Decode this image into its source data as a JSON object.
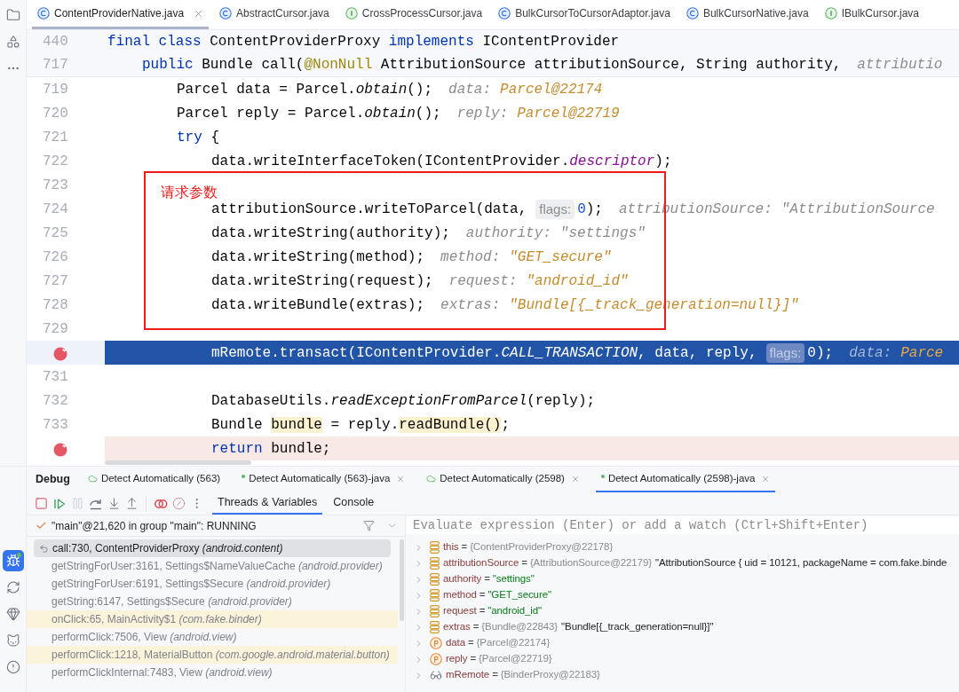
{
  "tool_strip": {
    "top": [
      {
        "kind": "project",
        "selected": false
      },
      {
        "kind": "structure",
        "selected": false
      },
      {
        "kind": "more",
        "selected": false
      }
    ],
    "bottom": [
      {
        "kind": "debug",
        "selected": true
      },
      {
        "kind": "sync",
        "selected": false
      },
      {
        "kind": "gem",
        "selected": false
      },
      {
        "kind": "cat",
        "selected": false
      },
      {
        "kind": "problems",
        "selected": false
      }
    ]
  },
  "editor_tabs": [
    {
      "label": "ContentProviderNative.java",
      "kind": "class",
      "selected": true
    },
    {
      "label": "AbstractCursor.java",
      "kind": "class",
      "selected": false
    },
    {
      "label": "CrossProcessCursor.java",
      "kind": "interface",
      "selected": false
    },
    {
      "label": "BulkCursorToCursorAdaptor.java",
      "kind": "class",
      "selected": false
    },
    {
      "label": "BulkCursorNative.java",
      "kind": "class",
      "selected": false
    },
    {
      "label": "IBulkCursor.java",
      "kind": "interface",
      "selected": false
    }
  ],
  "editor": {
    "lines": [
      {
        "number": "440",
        "pinned": true,
        "breakpoint": false,
        "current": false,
        "parts": [
          {
            "kind": "code",
            "tokens": [
              {
                "kind": "keyword",
                "text": "final class"
              },
              {
                "kind": "plain",
                "text": " ContentProviderProxy "
              },
              {
                "kind": "keyword",
                "text": "implements"
              },
              {
                "kind": "plain",
                "text": " IContentProvider"
              }
            ]
          }
        ],
        "children": [
          {
            "number": "717",
            "pinned": true,
            "breakpoint": false,
            "current": false,
            "parts": [
              {
                "kind": "code",
                "tokens": [
                  {
                    "kind": "keyword",
                    "text": "public"
                  },
                  {
                    "kind": "plain",
                    "text": " Bundle call("
                  },
                  {
                    "kind": "annotation",
                    "text": "@NonNull"
                  },
                  {
                    "kind": "plain",
                    "text": " AttributionSource attributionSource, String authority,"
                  }
                ]
              },
              {
                "kind": "debug",
                "name": "attributio"
              }
            ],
            "children": [
              {
                "number": "719",
                "pinned": false,
                "breakpoint": false,
                "current": false,
                "parts": [
                  {
                    "kind": "code",
                    "tokens": [
                      {
                        "kind": "plain",
                        "text": "Parcel data = Parcel."
                      },
                      {
                        "kind": "italic",
                        "text": "obtain"
                      },
                      {
                        "kind": "plain",
                        "text": "();"
                      }
                    ]
                  },
                  {
                    "kind": "debug",
                    "name": "data:",
                    "value": "Parcel@22174",
                    "changed": true
                  }
                ]
              },
              {
                "number": "720",
                "pinned": false,
                "breakpoint": false,
                "current": false,
                "parts": [
                  {
                    "kind": "code",
                    "tokens": [
                      {
                        "kind": "plain",
                        "text": "Parcel reply = Parcel."
                      },
                      {
                        "kind": "italic",
                        "text": "obtain"
                      },
                      {
                        "kind": "plain",
                        "text": "();"
                      }
                    ]
                  },
                  {
                    "kind": "debug",
                    "name": "reply:",
                    "value": "Parcel@22719",
                    "changed": true
                  }
                ]
              },
              {
                "number": "721",
                "pinned": false,
                "breakpoint": false,
                "current": false,
                "parts": [
                  {
                    "kind": "code",
                    "tokens": [
                      {
                        "kind": "keyword",
                        "text": "try"
                      },
                      {
                        "kind": "plain",
                        "text": " {"
                      }
                    ]
                  }
                ],
                "children": [
                  {
                    "number": "722",
                    "pinned": false,
                    "breakpoint": false,
                    "current": false,
                    "parts": [
                      {
                        "kind": "code",
                        "tokens": [
                          {
                            "kind": "plain",
                            "text": "data.writeInterfaceToken(IContentProvider."
                          },
                          {
                            "kind": "field",
                            "text": "descriptor"
                          },
                          {
                            "kind": "plain",
                            "text": ");"
                          }
                        ]
                      }
                    ]
                  },
                  {
                    "number": "723",
                    "pinned": false,
                    "breakpoint": false,
                    "current": false
                  },
                  {
                    "number": "724",
                    "pinned": false,
                    "breakpoint": false,
                    "current": false,
                    "parts": [
                      {
                        "kind": "code",
                        "tokens": [
                          {
                            "kind": "plain",
                            "text": "attributionSource.writeToParcel(data,"
                          }
                        ]
                      },
                      {
                        "kind": "inlay",
                        "text": "flags:"
                      },
                      {
                        "kind": "code",
                        "tokens": [
                          {
                            "kind": "number",
                            "text": "0"
                          },
                          {
                            "kind": "plain",
                            "text": ");"
                          }
                        ]
                      },
                      {
                        "kind": "debug",
                        "name": "attributionSource:",
                        "value": "\"AttributionSource",
                        "changed": false
                      }
                    ]
                  },
                  {
                    "number": "725",
                    "pinned": false,
                    "breakpoint": false,
                    "current": false,
                    "parts": [
                      {
                        "kind": "code",
                        "tokens": [
                          {
                            "kind": "plain",
                            "text": "data.writeString(authority);"
                          }
                        ]
                      },
                      {
                        "kind": "debug",
                        "name": "authority:",
                        "value": "\"settings\"",
                        "changed": false
                      }
                    ]
                  },
                  {
                    "number": "726",
                    "pinned": false,
                    "breakpoint": false,
                    "current": false,
                    "parts": [
                      {
                        "kind": "code",
                        "tokens": [
                          {
                            "kind": "plain",
                            "text": "data.writeString(method);"
                          }
                        ]
                      },
                      {
                        "kind": "debug",
                        "name": "method:",
                        "value": "\"GET_secure\"",
                        "changed": true
                      }
                    ]
                  },
                  {
                    "number": "727",
                    "pinned": false,
                    "breakpoint": false,
                    "current": false,
                    "parts": [
                      {
                        "kind": "code",
                        "tokens": [
                          {
                            "kind": "plain",
                            "text": "data.writeString(request);"
                          }
                        ]
                      },
                      {
                        "kind": "debug",
                        "name": "request:",
                        "value": "\"android_id\"",
                        "changed": true
                      }
                    ]
                  },
                  {
                    "number": "728",
                    "pinned": false,
                    "breakpoint": false,
                    "current": false,
                    "parts": [
                      {
                        "kind": "code",
                        "tokens": [
                          {
                            "kind": "plain",
                            "text": "data.writeBundle(extras);"
                          }
                        ]
                      },
                      {
                        "kind": "debug",
                        "name": "extras:",
                        "value": "\"Bundle[{_track_generation=null}]\"",
                        "changed": true
                      }
                    ]
                  },
                  {
                    "number": "729",
                    "pinned": false,
                    "breakpoint": false,
                    "current": false
                  },
                  {
                    "pinned": false,
                    "breakpoint": true,
                    "current": true,
                    "parts": [
                      {
                        "kind": "code",
                        "tokens": [
                          {
                            "kind": "plain",
                            "text": "mRemote.transact(IContentProvider."
                          },
                          {
                            "kind": "italic",
                            "text": "CALL_TRANSACTION"
                          },
                          {
                            "kind": "plain",
                            "text": ", data, reply,"
                          }
                        ]
                      },
                      {
                        "kind": "inlay",
                        "text": "flags:"
                      },
                      {
                        "kind": "code",
                        "tokens": [
                          {
                            "kind": "plain",
                            "text": "0);"
                          }
                        ]
                      },
                      {
                        "kind": "debug",
                        "name": "data:",
                        "value": "Parce",
                        "changed": true
                      }
                    ]
                  },
                  {
                    "number": "731",
                    "pinned": false,
                    "breakpoint": false,
                    "current": false
                  },
                  {
                    "number": "732",
                    "pinned": false,
                    "breakpoint": false,
                    "current": false,
                    "parts": [
                      {
                        "kind": "code",
                        "tokens": [
                          {
                            "kind": "plain",
                            "text": "DatabaseUtils."
                          },
                          {
                            "kind": "italic",
                            "text": "readExceptionFromParcel"
                          },
                          {
                            "kind": "plain",
                            "text": "(reply);"
                          }
                        ]
                      }
                    ]
                  },
                  {
                    "number": "733",
                    "pinned": false,
                    "breakpoint": false,
                    "current": false,
                    "parts": [
                      {
                        "kind": "code",
                        "tokens": [
                          {
                            "kind": "plain",
                            "text": "Bundle "
                          },
                          {
                            "kind": "usage",
                            "text": "bundle"
                          },
                          {
                            "kind": "plain",
                            "text": " = reply."
                          },
                          {
                            "kind": "usage",
                            "text": "readBundle()"
                          },
                          {
                            "kind": "plain",
                            "text": ";"
                          }
                        ]
                      }
                    ]
                  },
                  {
                    "pinned": false,
                    "breakpoint": true,
                    "current": false,
                    "parts": [
                      {
                        "kind": "code",
                        "tokens": [
                          {
                            "kind": "keyword",
                            "text": "return"
                          },
                          {
                            "kind": "plain",
                            "text": " bundle;"
                          }
                        ]
                      }
                    ]
                  }
                ]
              }
            ]
          }
        ]
      }
    ]
  },
  "annotation": {
    "label": "请求参数"
  },
  "debug": {
    "title": "Debug",
    "sessions": [
      {
        "label": "Detect Automatically (563)",
        "kind": "device",
        "closable": false,
        "selected": false
      },
      {
        "label": "Detect Automatically (563)-java",
        "kind": "process",
        "closable": true,
        "selected": false
      },
      {
        "label": "Detect Automatically (2598)",
        "kind": "device",
        "closable": true,
        "selected": false
      },
      {
        "label": "Detect Automatically (2598)-java",
        "kind": "process",
        "closable": true,
        "selected": true
      }
    ],
    "toolbar": [
      {
        "kind": "stop",
        "disabled": false
      },
      {
        "kind": "resume",
        "disabled": false
      },
      {
        "kind": "pause",
        "disabled": true
      },
      {
        "kind": "step_over",
        "disabled": false
      },
      {
        "kind": "step_into",
        "disabled": false
      },
      {
        "kind": "step_out",
        "disabled": false
      },
      {
        "kind": "view_breakpoints",
        "disabled": false
      },
      {
        "kind": "mute_breakpoints",
        "disabled": false
      },
      {
        "kind": "more",
        "disabled": false
      }
    ],
    "view_tabs": [
      {
        "label": "Threads & Variables",
        "selected": true
      },
      {
        "label": "Console",
        "selected": false
      }
    ],
    "thread": {
      "label": "\"main\"@21,620 in group \"main\": RUNNING"
    },
    "frames": [
      {
        "label": "call:730, ContentProviderProxy *(android.content)*",
        "selected": true,
        "highlighted": false
      },
      {
        "label": "getStringForUser:3161, Settings$NameValueCache *(android.provider)*",
        "selected": false,
        "highlighted": false
      },
      {
        "label": "getStringForUser:6191, Settings$Secure *(android.provider)*",
        "selected": false,
        "highlighted": false
      },
      {
        "label": "getString:6147, Settings$Secure *(android.provider)*",
        "selected": false,
        "highlighted": false
      },
      {
        "label": "onClick:65, MainActivity$1 *(com.fake.binder)*",
        "selected": false,
        "highlighted": true
      },
      {
        "label": "performClick:7506, View *(android.view)*",
        "selected": false,
        "highlighted": false
      },
      {
        "label": "performClick:1218, MaterialButton *(com.google.android.material.button)*",
        "selected": false,
        "highlighted": true
      },
      {
        "label": "performClickInternal:7483, View *(android.view)*",
        "selected": false,
        "highlighted": false
      }
    ],
    "evaluate": {
      "placeholder": "Evaluate expression (Enter) or add a watch (Ctrl+Shift+Enter)"
    },
    "variables": [
      {
        "name": "this",
        "kind": "parameter",
        "sep": "=",
        "ref": "{ContentProviderProxy@22178}"
      },
      {
        "name": "attributionSource",
        "kind": "parameter",
        "sep": "=",
        "ref": "{AttributionSource@22179}",
        "summary": "\"AttributionSource { uid = 10121, packageName = com.fake.binde"
      },
      {
        "name": "authority",
        "kind": "parameter",
        "sep": "=",
        "literal": "\"settings\""
      },
      {
        "name": "method",
        "kind": "parameter",
        "sep": "=",
        "literal": "\"GET_secure\""
      },
      {
        "name": "request",
        "kind": "parameter",
        "sep": "=",
        "literal": "\"android_id\""
      },
      {
        "name": "extras",
        "kind": "parameter",
        "sep": "=",
        "ref": "{Bundle@22843}",
        "summary": "\"Bundle[{_track_generation=null}]\""
      },
      {
        "name": "data",
        "kind": "local",
        "sep": "=",
        "ref": "{Parcel@22174}"
      },
      {
        "name": "reply",
        "kind": "local",
        "sep": "=",
        "ref": "{Parcel@22719}"
      },
      {
        "name": "mRemote",
        "kind": "field",
        "sep": "=",
        "ref": "{BinderProxy@22183}"
      }
    ]
  }
}
